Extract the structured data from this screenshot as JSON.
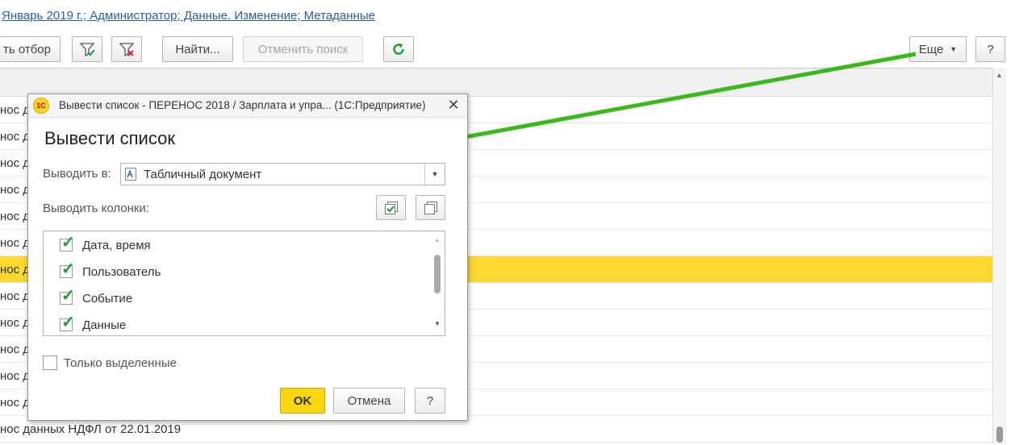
{
  "header": {
    "filter_text": "Январь 2019 г.; Администратор; Данные. Изменение; Метаданные"
  },
  "toolbar": {
    "set_filter_label": "ть отбор",
    "find_label": "Найти...",
    "cancel_search_label": "Отменить поиск",
    "more_label": "Еще",
    "help_label": "?",
    "icons": [
      "filter-settings-icon",
      "clear-filter-icon",
      "refresh-icon"
    ]
  },
  "rows": [
    "нос д",
    "нос д",
    "нос д",
    "нос д",
    "нос д",
    "нос д",
    "нос д",
    "нос д",
    "нос д",
    "нос д",
    "нос д",
    "нос д",
    "нос данных НДФЛ от 22.01.2019"
  ],
  "selected_row_index": 6,
  "dialog": {
    "window_title": "Вывести список - ПЕРЕНОС 2018 / Зарплата и упра...  (1С:Предприятие)",
    "logo_text": "1С",
    "heading": "Вывести список",
    "output_label": "Выводить в:",
    "output_value": "Табличный документ",
    "columns_label": "Выводить колонки:",
    "columns": [
      {
        "label": "Дата, время",
        "checked": true
      },
      {
        "label": "Пользователь",
        "checked": true
      },
      {
        "label": "Событие",
        "checked": true
      },
      {
        "label": "Данные",
        "checked": true
      }
    ],
    "only_selected_label": "Только выделенные",
    "only_selected_checked": false,
    "ok_label": "OK",
    "cancel_label": "Отмена",
    "help_label": "?",
    "close_glyph": "✕"
  },
  "colors": {
    "selected_row": "#fcd830",
    "ok_button": "#f8d711",
    "arrow": "#3cb81e",
    "link": "#2a5fa8",
    "check": "#1d9a38"
  }
}
